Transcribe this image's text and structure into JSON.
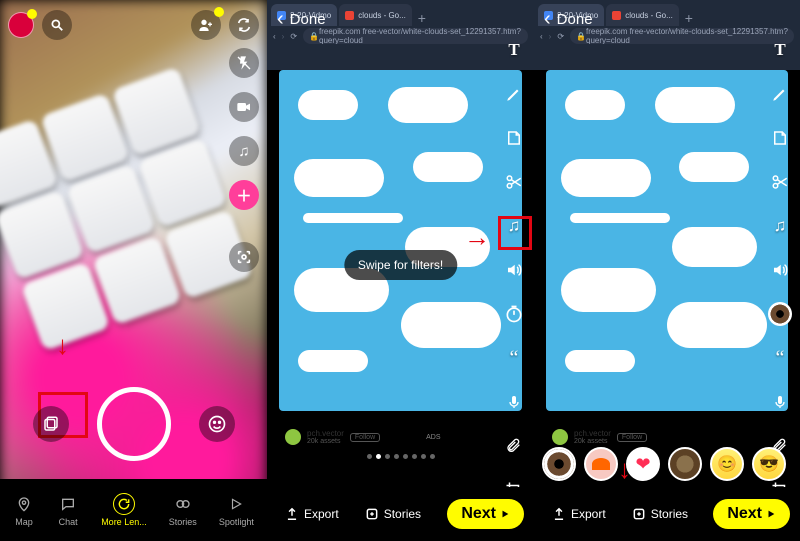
{
  "panel1": {
    "nav": {
      "map": "Map",
      "chat": "Chat",
      "more_lenses": "More Len...",
      "stories": "Stories",
      "spotlight": "Spotlight"
    }
  },
  "editor": {
    "done": "Done",
    "swipe_tip": "Swipe for filters!",
    "export": "Export",
    "stories": "Stories",
    "next": "Next",
    "tabs": {
      "vidmo": "2-20-Vidmo",
      "clouds": "clouds - Go..."
    },
    "url": "freepik.com free-vector/white-clouds-set_12291357.htm?query=cloud",
    "attrib": {
      "name": "pch.vector",
      "meta": "20k assets",
      "follow": "Follow",
      "ads": "ADS"
    }
  }
}
